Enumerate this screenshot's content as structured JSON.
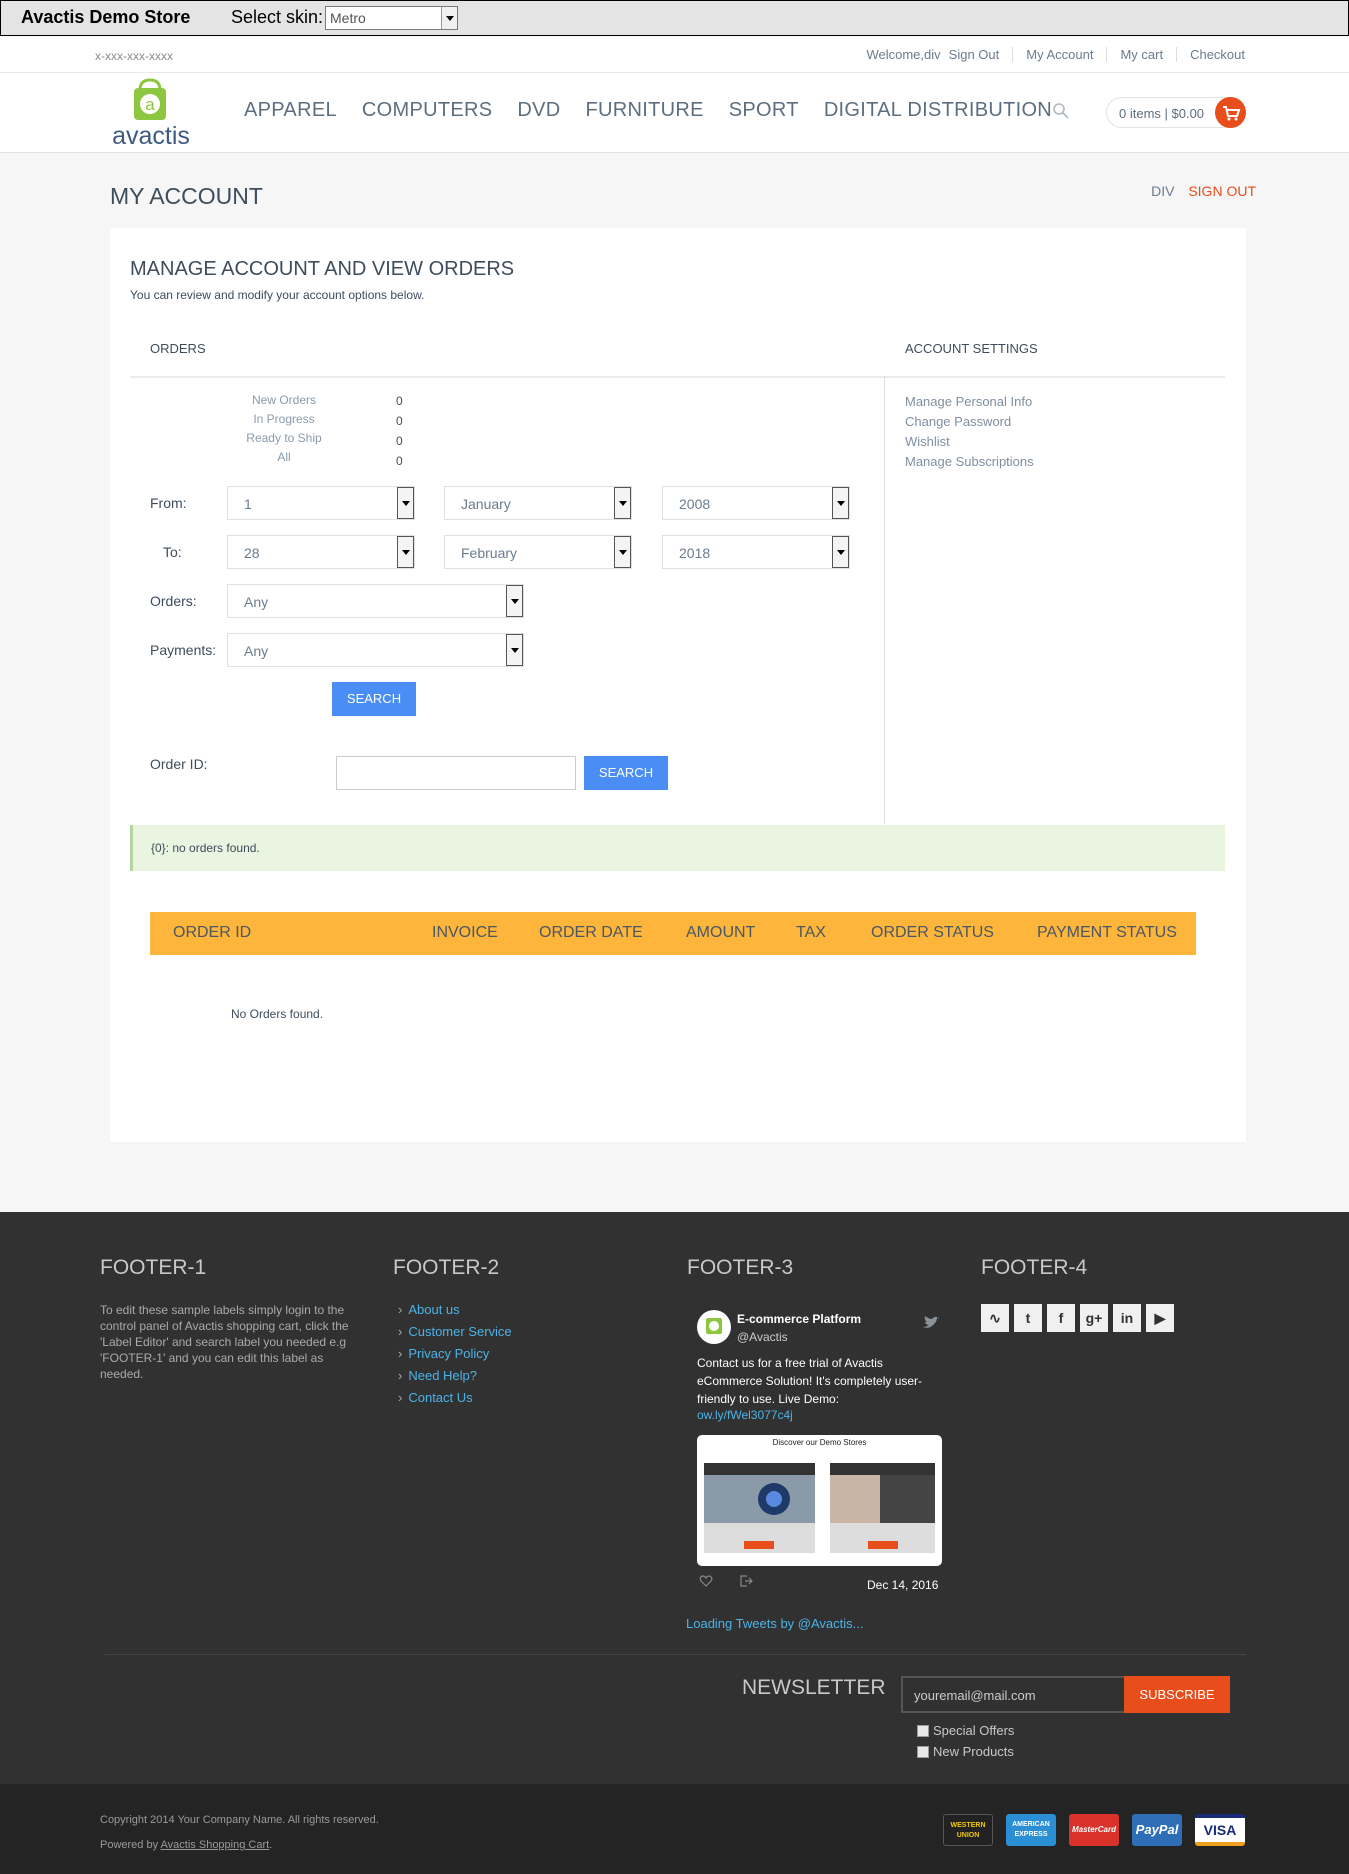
{
  "demo_bar": {
    "store_name": "Avactis Demo Store",
    "skin_label": "Select skin:",
    "skin_value": "Metro"
  },
  "topline": {
    "phone": "x-xxx-xxx-xxxx",
    "welcome": "Welcome,div",
    "sign_out": "Sign Out",
    "my_account": "My Account",
    "my_cart": "My cart",
    "checkout": "Checkout"
  },
  "header": {
    "logo_text": "avactis",
    "nav": [
      "APPAREL",
      "COMPUTERS",
      "DVD",
      "FURNITURE",
      "SPORT",
      "DIGITAL DISTRIBUTION"
    ],
    "cart_text": "0 items | $0.00"
  },
  "page": {
    "title": "MY ACCOUNT",
    "user": "DIV",
    "sign_out": "SIGN OUT",
    "heading": "MANAGE ACCOUNT AND VIEW ORDERS",
    "subheading": "You can review and modify your account options below.",
    "orders_label": "ORDERS",
    "settings_label": "ACCOUNT SETTINGS"
  },
  "order_counts": [
    {
      "label": "New Orders",
      "value": "0"
    },
    {
      "label": "In Progress",
      "value": "0"
    },
    {
      "label": "Ready to Ship",
      "value": "0"
    },
    {
      "label": "All",
      "value": "0"
    }
  ],
  "filters": {
    "from_label": "From:",
    "to_label": "To:",
    "from_day": "1",
    "from_month": "January",
    "from_year": "2008",
    "to_day": "28",
    "to_month": "February",
    "to_year": "2018",
    "orders_label": "Orders:",
    "orders_value": "Any",
    "payments_label": "Payments:",
    "payments_value": "Any",
    "search_label": "SEARCH",
    "order_id_label": "Order ID:",
    "order_id_value": "",
    "search2_label": "SEARCH"
  },
  "settings": [
    "Manage Personal Info",
    "Change Password",
    "Wishlist",
    "Manage Subscriptions"
  ],
  "alert": "{0}: no orders found.",
  "orders_table": {
    "columns": [
      "ORDER ID",
      "INVOICE",
      "ORDER DATE",
      "AMOUNT",
      "TAX",
      "ORDER STATUS",
      "PAYMENT STATUS"
    ],
    "empty": "No Orders found."
  },
  "footer": {
    "titles": [
      "FOOTER-1",
      "FOOTER-2",
      "FOOTER-3",
      "FOOTER-4"
    ],
    "text1": "To edit these sample labels simply login to the control panel of Avactis shopping cart, click the 'Label Editor' and search label you needed e.g 'FOOTER-1' and you can edit this label as needed.",
    "links": [
      "About us",
      "Customer Service",
      "Privacy Policy",
      "Need Help?",
      "Contact Us"
    ],
    "tweet": {
      "name": "E-commerce Platform",
      "handle": "@Avactis",
      "body": "Contact us for a free trial of Avactis eCommerce Solution! It's completely user-friendly to use.  Live Demo:",
      "link": "ow.ly/fWel3077c4j",
      "card_title": "Discover our Demo Stores",
      "date": "Dec 14, 2016"
    },
    "loading": "Loading Tweets by @Avactis...",
    "socials": [
      "rss-icon",
      "twitter-icon",
      "facebook-icon",
      "google-plus-icon",
      "linkedin-icon",
      "youtube-icon"
    ],
    "newsletter_title": "NEWSLETTER",
    "newsletter_placeholder": "youremail@mail.com",
    "subscribe": "SUBSCRIBE",
    "options": [
      "Special Offers",
      "New Products"
    ],
    "copyright": "Copyright 2014 Your Company Name. All rights reserved.",
    "powered_prefix": "Powered by ",
    "powered_link": "Avactis Shopping Cart",
    "powered_suffix": ".",
    "payments": [
      "WESTERN UNION",
      "AMERICAN EXPRESS",
      "MasterCard",
      "PayPal",
      "VISA"
    ]
  },
  "colors": {
    "accent": "#e84d1c",
    "blue": "#4a8ef5",
    "table_head": "#fdb53c",
    "footer_bg": "#313131"
  }
}
